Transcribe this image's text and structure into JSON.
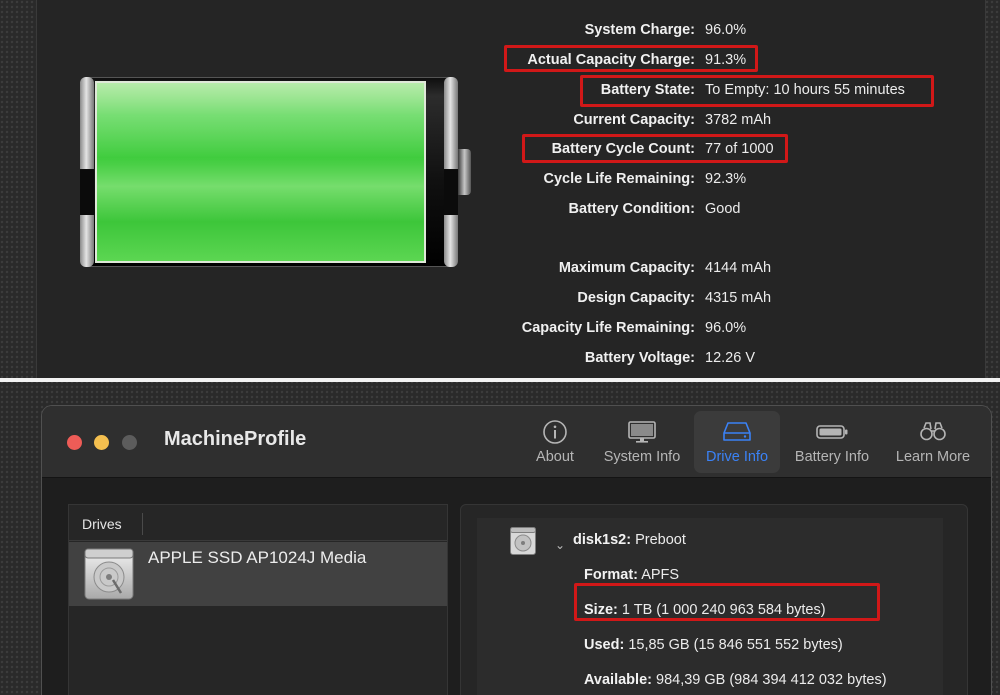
{
  "battery_stats": [
    {
      "label": "System Charge:",
      "value": "96.0%"
    },
    {
      "label": "Actual Capacity Charge:",
      "value": "91.3%"
    },
    {
      "label": "Battery State:",
      "value": "To Empty: 10 hours 55 minutes"
    },
    {
      "label": "Current Capacity:",
      "value": "3782 mAh"
    },
    {
      "label": "Battery Cycle Count:",
      "value": "77 of 1000"
    },
    {
      "label": "Cycle Life Remaining:",
      "value": "92.3%"
    },
    {
      "label": "Battery Condition:",
      "value": "Good"
    },
    {
      "label": "Maximum Capacity:",
      "value": "4144 mAh"
    },
    {
      "label": "Design Capacity:",
      "value": "4315 mAh"
    },
    {
      "label": "Capacity Life Remaining:",
      "value": "96.0%"
    },
    {
      "label": "Battery Voltage:",
      "value": "12.26 V"
    }
  ],
  "battery_level": 0.96,
  "app": {
    "title": "MachineProfile"
  },
  "toolbar": {
    "items": [
      {
        "label": "About",
        "icon": "info-icon"
      },
      {
        "label": "System Info",
        "icon": "monitor-icon"
      },
      {
        "label": "Drive Info",
        "icon": "drive-icon",
        "active": true
      },
      {
        "label": "Battery Info",
        "icon": "battery-icon"
      },
      {
        "label": "Learn More",
        "icon": "binoculars-icon"
      }
    ]
  },
  "drives": {
    "header": "Drives",
    "items": [
      {
        "name": "APPLE SSD AP1024J Media"
      }
    ]
  },
  "detail": {
    "disk_id": "disk1s2:",
    "disk_name": "Preboot",
    "format_label": "Format:",
    "format_value": "APFS",
    "size_label": "Size:",
    "size_value": "1 TB (1 000 240 963 584 bytes)",
    "used_label": "Used:",
    "used_value": "15,85 GB (15 846 551 552 bytes)",
    "available_label": "Available:",
    "available_value": "984,39 GB (984 394 412 032 bytes)"
  },
  "colors": {
    "highlight": "#d11818",
    "accent": "#3b82f6",
    "battery_green": "#3ccb3a"
  }
}
